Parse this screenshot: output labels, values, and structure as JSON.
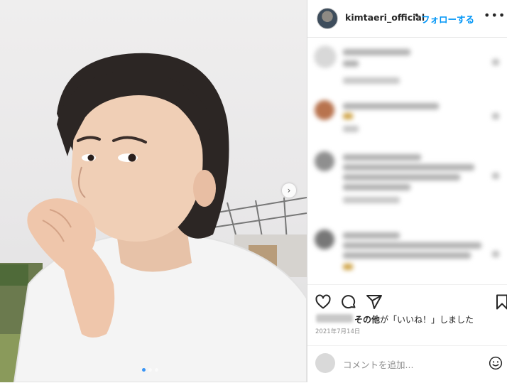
{
  "post": {
    "username": "kimtaeri_official",
    "separator": "•",
    "follow_label": "フォローする",
    "more_label": "•••",
    "next_arrow": "›",
    "carousel_total": 3,
    "carousel_active": 1
  },
  "likes": {
    "text": "が「いいね！」しました",
    "bold": "その他"
  },
  "date": "2021年7月14日",
  "comment_input": {
    "placeholder": "コメントを追加..."
  },
  "icons": [
    "heart-icon",
    "comment-icon",
    "share-icon",
    "bookmark-icon",
    "emoji-icon",
    "more-icon",
    "chevron-right-icon"
  ],
  "colors": {
    "accent": "#0095f6",
    "text": "#262626",
    "muted": "#8e8e8e",
    "divider": "#dbdbdb"
  }
}
